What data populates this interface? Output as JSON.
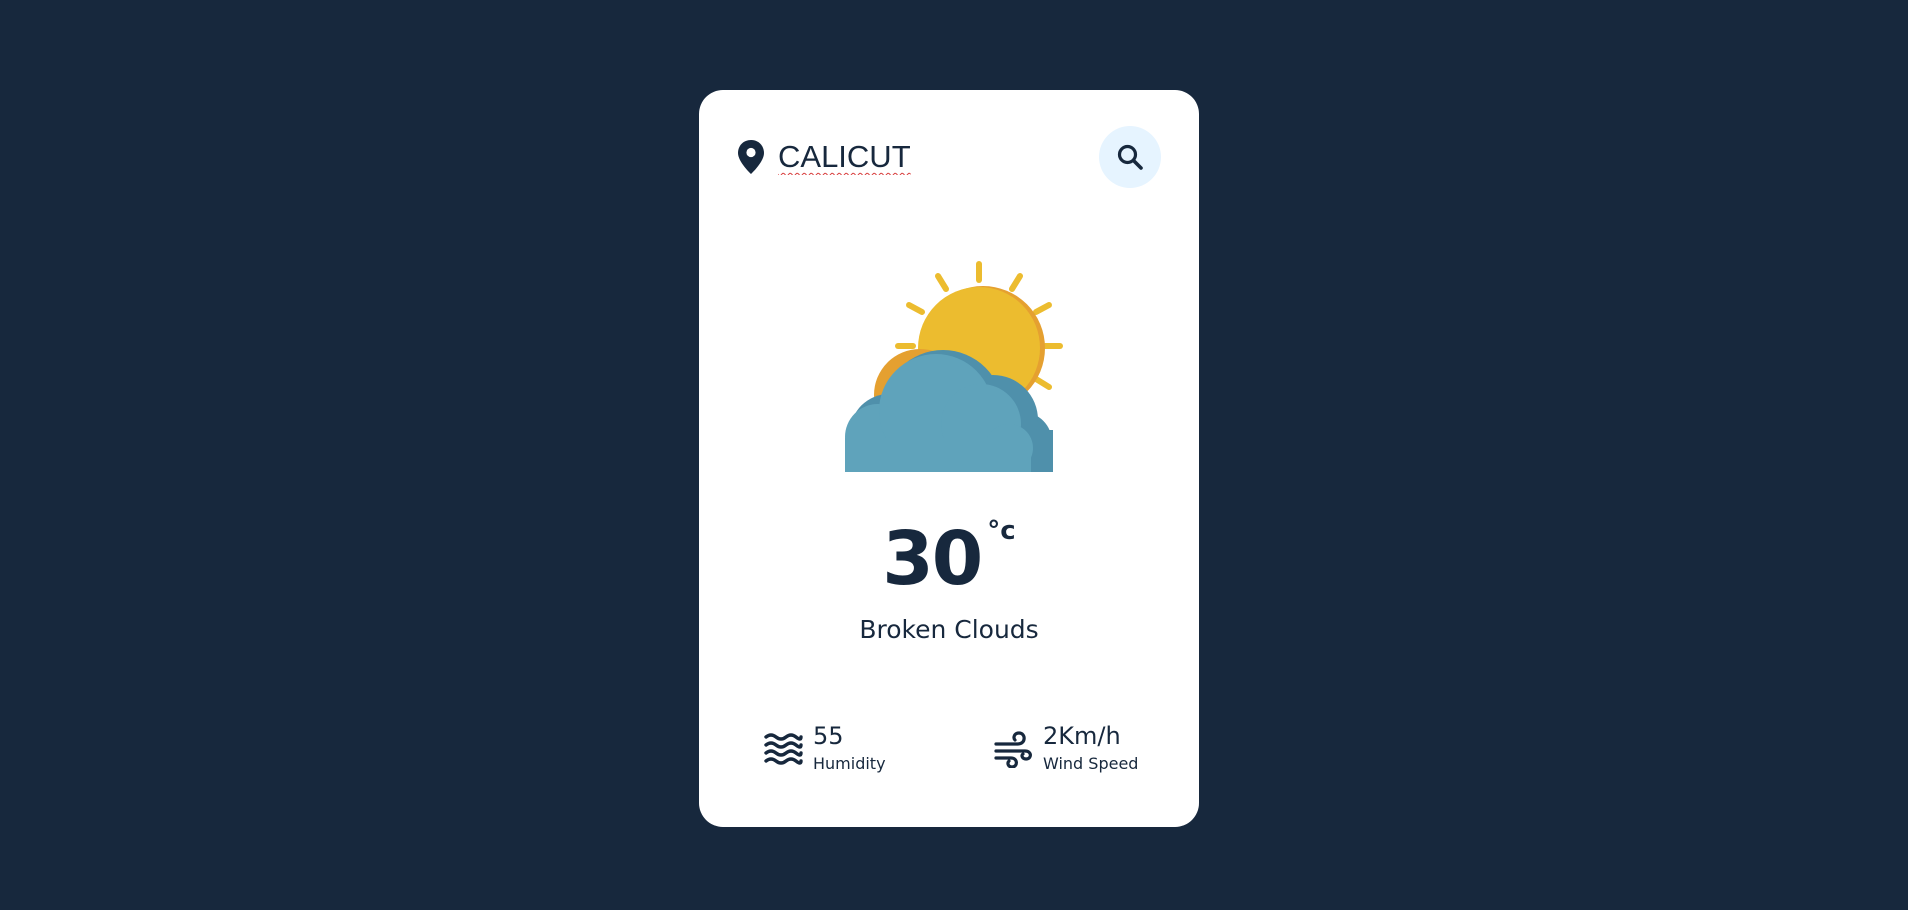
{
  "search": {
    "value": "CALICUT",
    "icon": "search-icon"
  },
  "location_icon": "map-pin-icon",
  "weather_icon": "partly-cloudy-icon",
  "weather": {
    "temperature": "30",
    "unit": "°c",
    "description": "Broken Clouds"
  },
  "details": {
    "humidity": {
      "value": "55",
      "label": "Humidity",
      "icon": "humidity-waves-icon"
    },
    "wind": {
      "value": "2Km/h",
      "label": "Wind Speed",
      "icon": "wind-icon"
    }
  },
  "colors": {
    "background": "#17283d",
    "card": "#ffffff",
    "text": "#17283d",
    "search_button_bg": "#e6f4ff",
    "sun": "#ecbc2f",
    "sun_shadow": "#e5a030",
    "cloud": "#5fa3bb",
    "cloud_shadow": "#4f90ab"
  }
}
